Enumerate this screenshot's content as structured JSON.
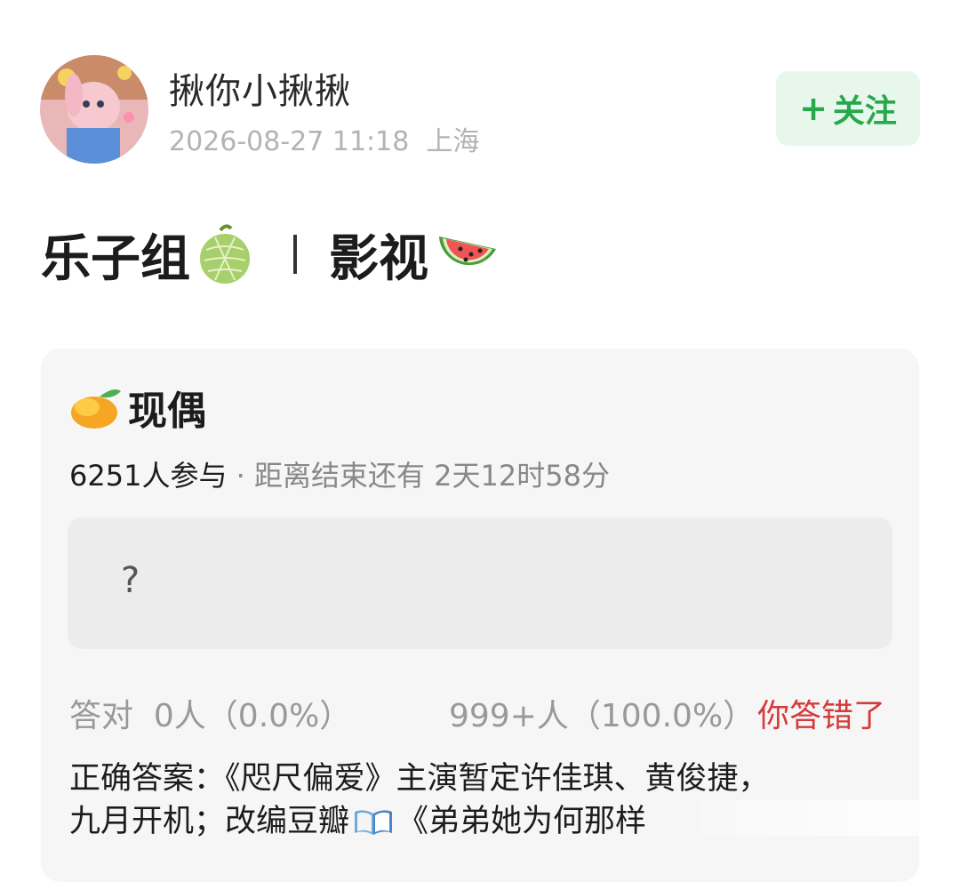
{
  "post": {
    "username": "揪你小揪揪",
    "timestamp": "2026-08-27 11:18",
    "location": "上海",
    "follow_plus": "+",
    "follow_label": "关注"
  },
  "group": {
    "title": "乐子组",
    "separator": "|",
    "category": "影视",
    "icons": [
      "melon-emoji",
      "watermelon-emoji"
    ]
  },
  "quiz": {
    "icon": "mango-emoji",
    "title": "现偶",
    "participants": "6251人参与",
    "dot": "·",
    "countdown": "距离结束还有 2天12时58分",
    "answer_text": "?",
    "correct_label": "答对",
    "correct_stat": "0人（0.0%）",
    "wrong_stat": "999+人（100.0%）",
    "result": "你答错了",
    "answer_prefix": "正确答案：",
    "answer_line1": "《咫尺偏爱》主演暂定许佳琪、黄俊捷，",
    "answer_line2a": "九月开机；改编豆瓣",
    "answer_line2b": "《弟弟她为何那样",
    "book_icon": "open-book-emoji"
  },
  "colors": {
    "accent_green": "#26a84c",
    "follow_bg": "#e8f7ec",
    "wrong_red": "#d63a3a"
  }
}
